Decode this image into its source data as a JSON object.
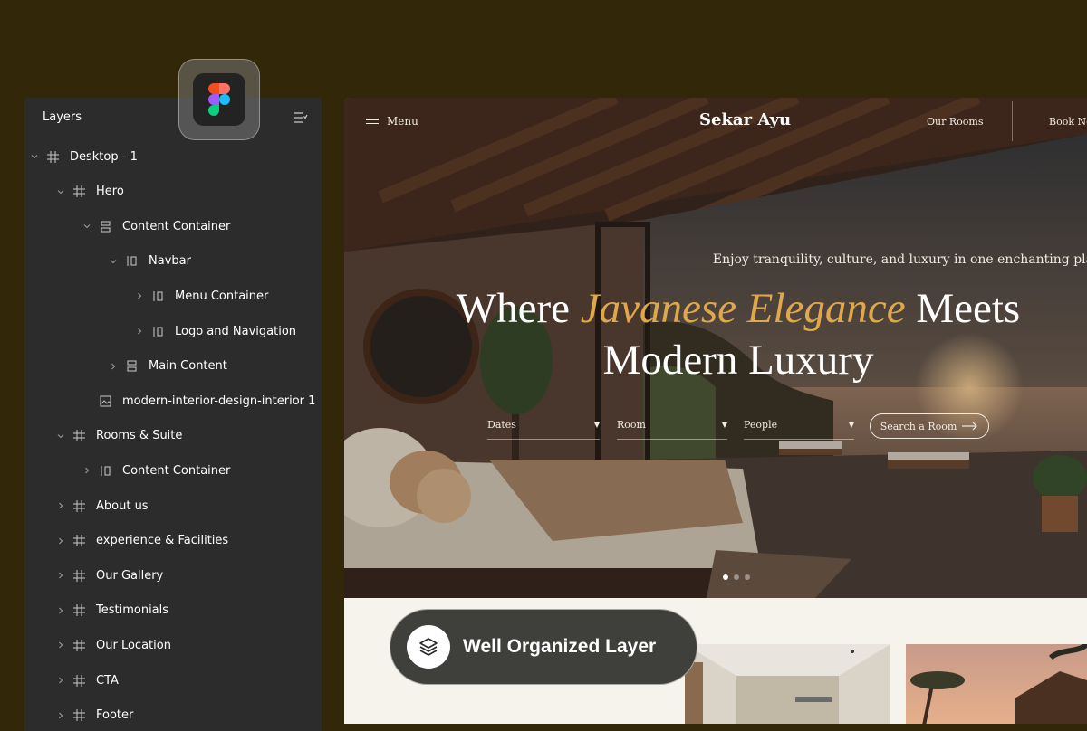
{
  "layers_panel": {
    "title": "Layers",
    "items": [
      {
        "label": "Desktop - 1",
        "icon": "frame-icon",
        "expanded": true
      },
      {
        "label": "Hero",
        "icon": "frame-icon",
        "expanded": true
      },
      {
        "label": "Content Container",
        "icon": "vertical-auto-layout-icon",
        "expanded": true
      },
      {
        "label": "Navbar",
        "icon": "horizontal-auto-layout-icon",
        "expanded": true
      },
      {
        "label": "Menu Container",
        "icon": "horizontal-auto-layout-icon",
        "expanded": false
      },
      {
        "label": "Logo and Navigation",
        "icon": "horizontal-auto-layout-icon",
        "expanded": false
      },
      {
        "label": "Main Content",
        "icon": "vertical-auto-layout-icon",
        "expanded": false
      },
      {
        "label": "modern-interior-design-interior 1",
        "icon": "image-icon",
        "expanded": null
      },
      {
        "label": "Rooms & Suite",
        "icon": "frame-icon",
        "expanded": true
      },
      {
        "label": "Content Container",
        "icon": "horizontal-auto-layout-icon",
        "expanded": false
      },
      {
        "label": "About us",
        "icon": "frame-icon",
        "expanded": false
      },
      {
        "label": "experience & Facilities",
        "icon": "frame-icon",
        "expanded": false
      },
      {
        "label": "Our Gallery",
        "icon": "frame-icon",
        "expanded": false
      },
      {
        "label": "Testimonials",
        "icon": "frame-icon",
        "expanded": false
      },
      {
        "label": "Our Location",
        "icon": "frame-icon",
        "expanded": false
      },
      {
        "label": "CTA",
        "icon": "frame-icon",
        "expanded": false
      },
      {
        "label": "Footer",
        "icon": "frame-icon",
        "expanded": false
      }
    ]
  },
  "badge": {
    "icon": "figma-logo-icon"
  },
  "site": {
    "nav": {
      "menu_label": "Menu",
      "logo": "Sekar Ayu",
      "rooms_link": "Our Rooms",
      "book_link": "Book No"
    },
    "hero": {
      "tagline": "Enjoy tranquility, culture, and luxury in one enchanting place",
      "title_start": "Where",
      "title_accent": "Javanese Elegance",
      "title_mid": "Meets",
      "title_end": "Modern Luxury"
    },
    "search": {
      "dates": "Dates",
      "room": "Room",
      "people": "People",
      "button": "Search a Room"
    }
  },
  "callout": {
    "label": "Well Organized Layer",
    "icon": "layers-stack-icon"
  },
  "colors": {
    "background": "#33270a",
    "panel": "#2c2c2c",
    "accent": "#e0a84a",
    "section_bg": "#f6f3ec"
  }
}
